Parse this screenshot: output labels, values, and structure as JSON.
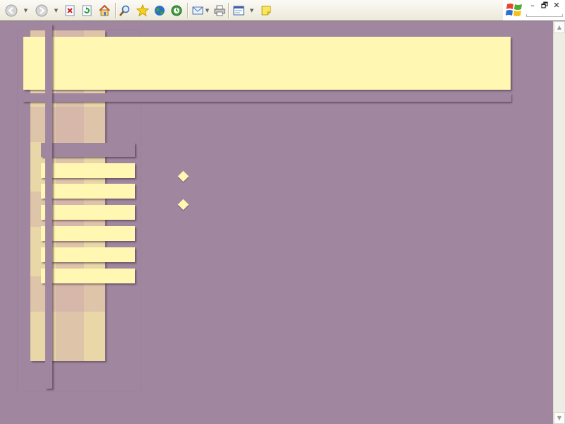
{
  "toolbar": {
    "buttons": [
      {
        "name": "back-button",
        "icon": "back-arrow-icon",
        "has_dropdown": true
      },
      {
        "name": "forward-button",
        "icon": "forward-arrow-icon",
        "has_dropdown": true
      },
      {
        "name": "stop-button",
        "icon": "stop-icon"
      },
      {
        "name": "refresh-button",
        "icon": "refresh-icon"
      },
      {
        "name": "home-button",
        "icon": "home-icon"
      },
      {
        "name": "search-button",
        "icon": "search-icon"
      },
      {
        "name": "favorites-button",
        "icon": "star-icon"
      },
      {
        "name": "media-button",
        "icon": "globe-icon"
      },
      {
        "name": "history-button",
        "icon": "history-icon"
      },
      {
        "name": "mail-button",
        "icon": "mail-icon",
        "has_dropdown": true
      },
      {
        "name": "print-button",
        "icon": "printer-icon"
      },
      {
        "name": "edit-button",
        "icon": "edit-page-icon",
        "has_dropdown": true
      },
      {
        "name": "note-button",
        "icon": "sticky-note-icon"
      }
    ]
  },
  "window_controls": {
    "logo": "windows-logo-icon",
    "minimize_glyph": "–",
    "restore_glyph": "🗗",
    "close_glyph": "✕"
  },
  "page": {
    "nav_items": [
      "",
      "",
      "",
      "",
      "",
      ""
    ],
    "bullets": 2,
    "colors": {
      "background": "#a0879f",
      "banner": "#fff7b2",
      "stripe_pattern": "#e9d7a8"
    }
  }
}
